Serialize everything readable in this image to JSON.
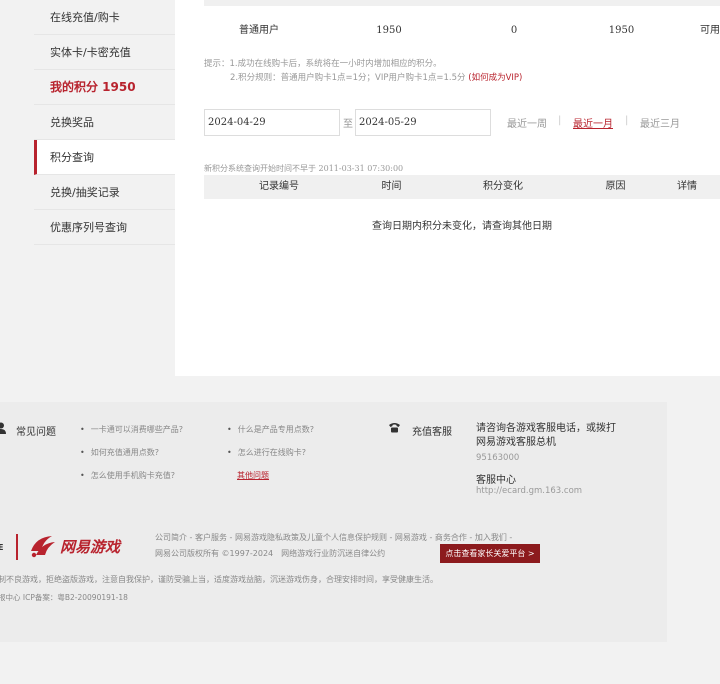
{
  "sidebar": {
    "items": [
      {
        "label": "在线充值/购卡"
      },
      {
        "label": "实体卡/卡密充值"
      },
      {
        "label": "我的积分 1950"
      },
      {
        "label": "兑换奖品"
      },
      {
        "label": "积分查询"
      },
      {
        "label": "兑换/抽奖记录"
      },
      {
        "label": "优惠序列号查询"
      }
    ]
  },
  "user_row": {
    "type": "普通用户",
    "total": "1950",
    "frozen": "0",
    "available": "1950",
    "status": "可用"
  },
  "tips": {
    "prefix": "提示：",
    "line1": "1.成功在线购卡后，系统将在一小时内增加相应的积分。",
    "line2": "2.积分规则：普通用户购卡1点=1分；VIP用户购卡1点=1.5分 ",
    "vip_link": "(如何成为VIP)"
  },
  "query": {
    "start_date": "2024-04-29",
    "to_label": "至",
    "end_date": "2024-05-29",
    "range_week": "最近一周",
    "range_month": "最近一月",
    "range_quarter": "最近三月",
    "separator": "|"
  },
  "note": "新积分系统查询开始时间不早于 2011-03-31 07:30:00",
  "table": {
    "headers": [
      "记录编号",
      "时间",
      "积分变化",
      "原因",
      "详情"
    ],
    "empty_message": "查询日期内积分未变化，请查询其他日期"
  },
  "footer": {
    "faq_title": "常见问题",
    "faq_links": [
      "一卡通可以消费哪些产品?",
      "什么是产品专用点数?",
      "如何充值通用点数?",
      "怎么进行在线购卡?",
      "怎么使用手机购卡充值?"
    ],
    "faq_more": "其他问题",
    "cs_title": "充值客服",
    "cs_text": "请咨询各游戏客服电话，或拨打网易游戏客服总机",
    "cs_phone": "95163000",
    "cs_center": "客服中心",
    "cs_url": "http://ecard.gm.163.com",
    "brand_partial": "E",
    "logo_text": "网易游戏",
    "links": "公司简介 - 客户服务 - 网易游戏隐私政策及儿童个人信息保护规则 - 网易游戏 - 商务合作 - 加入我们 -",
    "copyright": "网易公司版权所有 ©1997-2024　网络游戏行业防沉迷自律公约",
    "parent_btn": "点击查看家长关爱平台 >",
    "warning": "制不良游戏，拒绝盗版游戏，注意自我保护，谨防受骗上当，适度游戏益脑，沉迷游戏伤身，合理安排时间，享受健康生活。",
    "icp": "报中心 ICP备案：粤B2-20090191-18"
  },
  "colors": {
    "accent": "#b8232e",
    "button_dark": "#8c1a1d"
  }
}
